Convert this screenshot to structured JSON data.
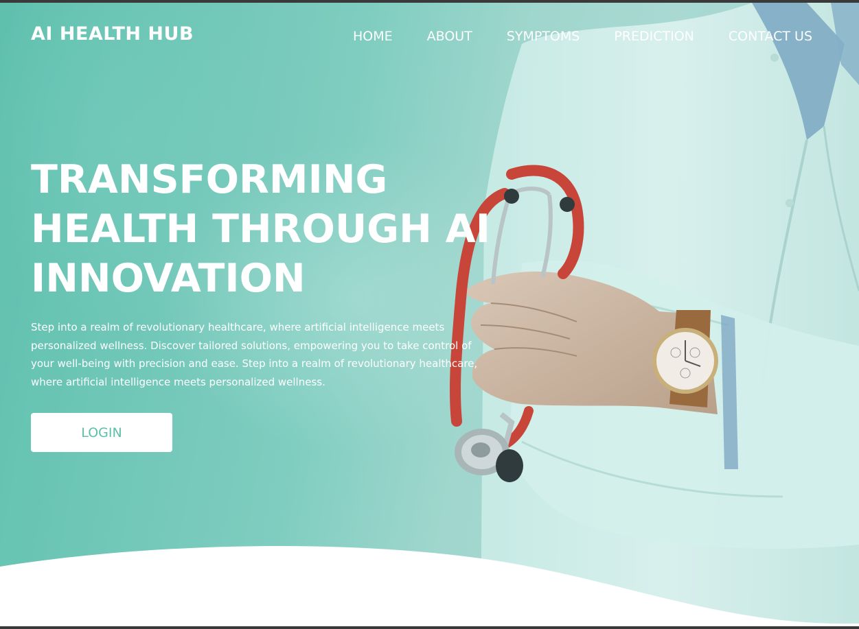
{
  "nav": {
    "brand": "AI HEALTH HUB",
    "links": [
      {
        "label": "HOME"
      },
      {
        "label": "ABOUT"
      },
      {
        "label": "SYMPTOMS"
      },
      {
        "label": "PREDICTION"
      },
      {
        "label": "CONTACT US"
      }
    ]
  },
  "hero": {
    "title_lines": [
      "TRANSFORMING",
      "HEALTH THROUGH AI",
      "INNOVATION"
    ],
    "description": "Step into a realm of revolutionary healthcare, where artificial intelligence meets personalized wellness. Discover tailored solutions, empowering you to take control of your well-being with precision and ease. Step into a realm of revolutionary healthcare, where artificial intelligence meets personalized wellness.",
    "login_label": "LOGIN"
  },
  "colors": {
    "accent": "#5cbfa9",
    "hero_bg": "#7fcdc0",
    "stethoscope": "#c8453a"
  }
}
